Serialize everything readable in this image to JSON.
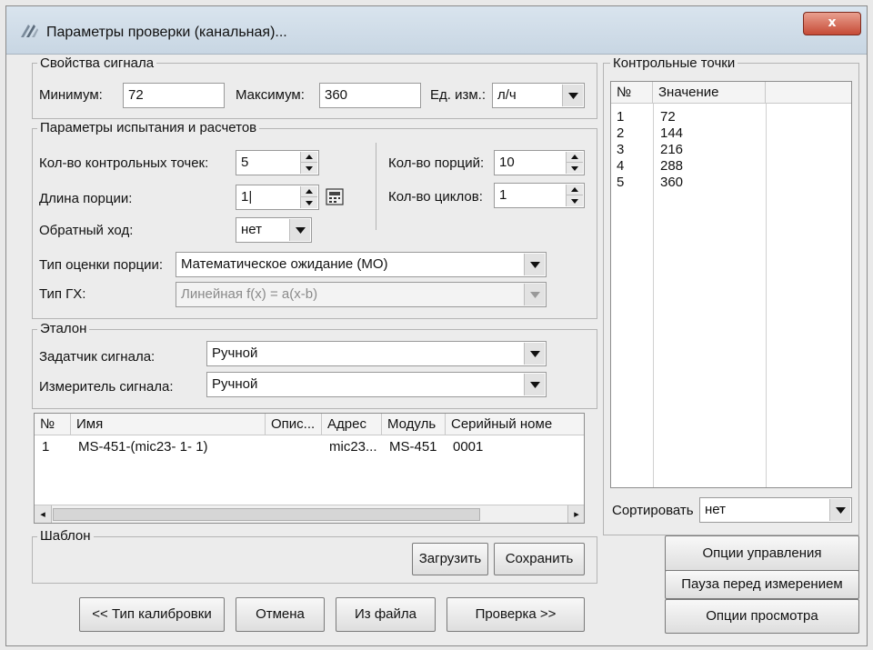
{
  "window": {
    "title": "Параметры проверки (канальная)...",
    "close_label": "x"
  },
  "signal": {
    "group_label": "Свойства сигнала",
    "min_label": "Минимум:",
    "min_value": "72",
    "max_label": "Максимум:",
    "max_value": "360",
    "unit_label": "Ед. изм.:",
    "unit_value": "л/ч"
  },
  "test": {
    "group_label": "Параметры испытания и расчетов",
    "points_label": "Кол-во контрольных точек:",
    "points_value": "5",
    "portion_len_label": "Длина порции:",
    "portion_len_value": "1|",
    "reverse_label": "Обратный ход:",
    "reverse_value": "нет",
    "portions_label": "Кол-во порций:",
    "portions_value": "10",
    "cycles_label": "Кол-во циклов:",
    "cycles_value": "1",
    "estimate_label": "Тип оценки порции:",
    "estimate_value": "Математическое ожидание (МО)",
    "gx_label": "Тип ГХ:",
    "gx_value": "Линейная f(x) = a(x-b)"
  },
  "etalon": {
    "group_label": "Эталон",
    "setter_label": "Задатчик сигнала:",
    "setter_value": "Ручной",
    "meter_label": "Измеритель сигнала:",
    "meter_value": "Ручной"
  },
  "devices": {
    "columns": [
      "№",
      "Имя",
      "Опис...",
      "Адрес",
      "Модуль",
      "Серийный номе"
    ],
    "rows": [
      [
        "1",
        "MS-451-(mic23- 1- 1)",
        "",
        "mic23...",
        "MS-451",
        "0001"
      ]
    ],
    "scroll_left": "◂",
    "scroll_right": "▸"
  },
  "template": {
    "group_label": "Шаблон",
    "load_label": "Загрузить",
    "save_label": "Сохранить"
  },
  "bottom": {
    "back_label": "<< Тип калибровки",
    "cancel_label": "Отмена",
    "from_file_label": "Из файла",
    "check_label": "Проверка >>"
  },
  "checkpoints": {
    "group_label": "Контрольные точки",
    "columns": [
      "№",
      "Значение"
    ],
    "rows": [
      [
        "1",
        "72"
      ],
      [
        "2",
        "144"
      ],
      [
        "3",
        "216"
      ],
      [
        "4",
        "288"
      ],
      [
        "5",
        "360"
      ]
    ],
    "sort_label": "Сортировать",
    "sort_value": "нет"
  },
  "side_buttons": {
    "control_label": "Опции управления",
    "pause_label": "Пауза перед измерением",
    "view_label": "Опции просмотра"
  }
}
